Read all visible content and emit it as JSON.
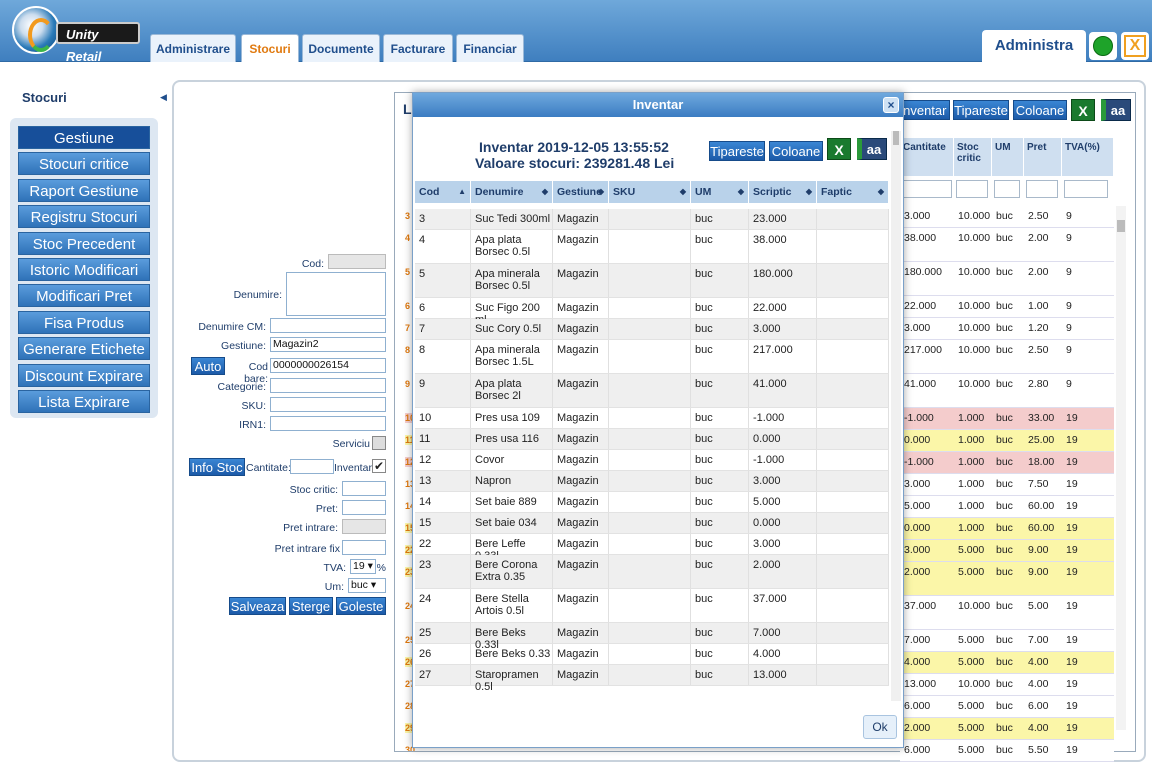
{
  "app": {
    "logo_text": "Unity Retail",
    "user": "Administra",
    "close_label": "X"
  },
  "tabs": [
    {
      "label": "Administrare",
      "active": false
    },
    {
      "label": "Stocuri",
      "active": true
    },
    {
      "label": "Documente",
      "active": false
    },
    {
      "label": "Facturare",
      "active": false
    },
    {
      "label": "Financiar",
      "active": false
    }
  ],
  "sidebar": {
    "title": "Stocuri",
    "items": [
      "Gestiune",
      "Stocuri critice",
      "Raport Gestiune",
      "Registru Stocuri",
      "Stoc Precedent",
      "Istoric Modificari",
      "Modificari Pret",
      "Fisa Produs",
      "Generare Etichete",
      "Discount Expirare",
      "Lista Expirare"
    ]
  },
  "form": {
    "cod_label": "Cod:",
    "denumire_label": "Denumire:",
    "denumire_cm_label": "Denumire CM:",
    "gestiune_label": "Gestiune:",
    "gestiune_value": "Magazin2",
    "auto_label": "Auto",
    "cod_bare_label": "Cod bare:",
    "cod_bare_value": "0000000026154",
    "categorie_label": "Categorie:",
    "sku_label": "SKU:",
    "irn_label": "IRN1:",
    "serviciu_label": "Serviciu",
    "info_stoc_label": "Info Stoc",
    "cantitate_label": "Cantitate:",
    "inventar_label": "Inventar",
    "inventar_checked": "✔",
    "stoc_critic_label": "Stoc critic:",
    "pret_label": "Pret:",
    "pret_intrare_label": "Pret intrare:",
    "pret_intrare_fix_label": "Pret intrare fix",
    "tva_label": "TVA:",
    "tva_value": "19 ▾",
    "tva_unit": "%",
    "um_label": "Um:",
    "um_value": "buc ▾",
    "save_label": "Salveaza",
    "delete_label": "Sterge",
    "clear_label": "Goleste"
  },
  "list": {
    "title_fragment": "Li",
    "toolbar": {
      "inventar_label": "Inventar",
      "print_label": "Tipareste",
      "columns_label": "Coloane",
      "excel_label": "X",
      "font_label": "aa"
    },
    "headers": [
      "Cantitate",
      "Stoc critic",
      "UM",
      "Pret",
      "TVA(%)"
    ],
    "left_fragments": [
      "3",
      "4",
      "5",
      "6",
      "7",
      "8",
      "9",
      "10",
      "11",
      "12",
      "13",
      "14",
      "15",
      "22",
      "23",
      "24",
      "25",
      "26",
      "27",
      "28",
      "29",
      "30"
    ],
    "rows": [
      {
        "qty": "3.000",
        "crit": "10.000",
        "um": "buc",
        "pret": "2.50",
        "tva": "9",
        "status": "normal"
      },
      {
        "qty": "38.000",
        "crit": "10.000",
        "um": "buc",
        "pret": "2.00",
        "tva": "9",
        "status": "normal"
      },
      {
        "qty": "180.000",
        "crit": "10.000",
        "um": "buc",
        "pret": "2.00",
        "tva": "9",
        "status": "normal"
      },
      {
        "qty": "22.000",
        "crit": "10.000",
        "um": "buc",
        "pret": "1.00",
        "tva": "9",
        "status": "normal"
      },
      {
        "qty": "3.000",
        "crit": "10.000",
        "um": "buc",
        "pret": "1.20",
        "tva": "9",
        "status": "normal"
      },
      {
        "qty": "217.000",
        "crit": "10.000",
        "um": "buc",
        "pret": "2.50",
        "tva": "9",
        "status": "normal"
      },
      {
        "qty": "41.000",
        "crit": "10.000",
        "um": "buc",
        "pret": "2.80",
        "tva": "9",
        "status": "normal"
      },
      {
        "qty": "-1.000",
        "crit": "1.000",
        "um": "buc",
        "pret": "33.00",
        "tva": "19",
        "status": "negative"
      },
      {
        "qty": "0.000",
        "crit": "1.000",
        "um": "buc",
        "pret": "25.00",
        "tva": "19",
        "status": "zero"
      },
      {
        "qty": "-1.000",
        "crit": "1.000",
        "um": "buc",
        "pret": "18.00",
        "tva": "19",
        "status": "negative"
      },
      {
        "qty": "3.000",
        "crit": "1.000",
        "um": "buc",
        "pret": "7.50",
        "tva": "19",
        "status": "normal"
      },
      {
        "qty": "5.000",
        "crit": "1.000",
        "um": "buc",
        "pret": "60.00",
        "tva": "19",
        "status": "normal"
      },
      {
        "qty": "0.000",
        "crit": "1.000",
        "um": "buc",
        "pret": "60.00",
        "tva": "19",
        "status": "zero"
      },
      {
        "qty": "3.000",
        "crit": "5.000",
        "um": "buc",
        "pret": "9.00",
        "tva": "19",
        "status": "zero"
      },
      {
        "qty": "2.000",
        "crit": "5.000",
        "um": "buc",
        "pret": "9.00",
        "tva": "19",
        "status": "zero"
      },
      {
        "qty": "37.000",
        "crit": "10.000",
        "um": "buc",
        "pret": "5.00",
        "tva": "19",
        "status": "normal"
      },
      {
        "qty": "7.000",
        "crit": "5.000",
        "um": "buc",
        "pret": "7.00",
        "tva": "19",
        "status": "normal"
      },
      {
        "qty": "4.000",
        "crit": "5.000",
        "um": "buc",
        "pret": "4.00",
        "tva": "19",
        "status": "zero"
      },
      {
        "qty": "13.000",
        "crit": "10.000",
        "um": "buc",
        "pret": "4.00",
        "tva": "19",
        "status": "normal"
      },
      {
        "qty": "6.000",
        "crit": "5.000",
        "um": "buc",
        "pret": "6.00",
        "tva": "19",
        "status": "normal"
      },
      {
        "qty": "2.000",
        "crit": "5.000",
        "um": "buc",
        "pret": "4.00",
        "tva": "19",
        "status": "zero"
      },
      {
        "qty": "6.000",
        "crit": "5.000",
        "um": "buc",
        "pret": "5.50",
        "tva": "19",
        "status": "normal"
      }
    ]
  },
  "dialog": {
    "title": "Inventar",
    "close_icon": "×",
    "heading": "Inventar 2019-12-05 13:55:52",
    "subheading": "Valoare stocuri: 239281.48 Lei",
    "print_label": "Tipareste",
    "columns_label": "Coloane",
    "excel_label": "X",
    "font_label": "aa",
    "ok_label": "Ok",
    "headers": [
      "Cod",
      "Denumire",
      "Gestiune",
      "SKU",
      "UM",
      "Scriptic",
      "Faptic"
    ],
    "rows": [
      {
        "cod": "3",
        "den": "Suc Tedi 300ml",
        "gest": "Magazin",
        "sku": "",
        "um": "buc",
        "scriptic": "23.000",
        "faptic": ""
      },
      {
        "cod": "4",
        "den": "Apa plata Borsec 0.5l",
        "gest": "Magazin",
        "sku": "",
        "um": "buc",
        "scriptic": "38.000",
        "faptic": ""
      },
      {
        "cod": "5",
        "den": "Apa minerala Borsec 0.5l",
        "gest": "Magazin",
        "sku": "",
        "um": "buc",
        "scriptic": "180.000",
        "faptic": ""
      },
      {
        "cod": "6",
        "den": "Suc Figo 200 ml",
        "gest": "Magazin",
        "sku": "",
        "um": "buc",
        "scriptic": "22.000",
        "faptic": ""
      },
      {
        "cod": "7",
        "den": "Suc Cory 0.5l",
        "gest": "Magazin",
        "sku": "",
        "um": "buc",
        "scriptic": "3.000",
        "faptic": ""
      },
      {
        "cod": "8",
        "den": "Apa minerala Borsec 1.5L",
        "gest": "Magazin",
        "sku": "",
        "um": "buc",
        "scriptic": "217.000",
        "faptic": ""
      },
      {
        "cod": "9",
        "den": "Apa plata Borsec 2l",
        "gest": "Magazin",
        "sku": "",
        "um": "buc",
        "scriptic": "41.000",
        "faptic": ""
      },
      {
        "cod": "10",
        "den": "Pres usa 109",
        "gest": "Magazin",
        "sku": "",
        "um": "buc",
        "scriptic": "-1.000",
        "faptic": ""
      },
      {
        "cod": "11",
        "den": "Pres usa 116",
        "gest": "Magazin",
        "sku": "",
        "um": "buc",
        "scriptic": "0.000",
        "faptic": ""
      },
      {
        "cod": "12",
        "den": "Covor",
        "gest": "Magazin",
        "sku": "",
        "um": "buc",
        "scriptic": "-1.000",
        "faptic": ""
      },
      {
        "cod": "13",
        "den": "Napron",
        "gest": "Magazin",
        "sku": "",
        "um": "buc",
        "scriptic": "3.000",
        "faptic": ""
      },
      {
        "cod": "14",
        "den": "Set baie 889",
        "gest": "Magazin",
        "sku": "",
        "um": "buc",
        "scriptic": "5.000",
        "faptic": ""
      },
      {
        "cod": "15",
        "den": "Set baie 034",
        "gest": "Magazin",
        "sku": "",
        "um": "buc",
        "scriptic": "0.000",
        "faptic": ""
      },
      {
        "cod": "22",
        "den": "Bere Leffe 0.33l",
        "gest": "Magazin",
        "sku": "",
        "um": "buc",
        "scriptic": "3.000",
        "faptic": ""
      },
      {
        "cod": "23",
        "den": "Bere Corona Extra 0.35",
        "gest": "Magazin",
        "sku": "",
        "um": "buc",
        "scriptic": "2.000",
        "faptic": ""
      },
      {
        "cod": "24",
        "den": "Bere Stella Artois 0.5l",
        "gest": "Magazin",
        "sku": "",
        "um": "buc",
        "scriptic": "37.000",
        "faptic": ""
      },
      {
        "cod": "25",
        "den": "Bere Beks 0.33l",
        "gest": "Magazin",
        "sku": "",
        "um": "buc",
        "scriptic": "7.000",
        "faptic": ""
      },
      {
        "cod": "26",
        "den": "Bere Beks 0.33",
        "gest": "Magazin",
        "sku": "",
        "um": "buc",
        "scriptic": "4.000",
        "faptic": ""
      },
      {
        "cod": "27",
        "den": "Staropramen 0.5l",
        "gest": "Magazin",
        "sku": "",
        "um": "buc",
        "scriptic": "13.000",
        "faptic": ""
      }
    ]
  },
  "colors": {
    "accent": "#1c5aa8",
    "tab_active": "#e07a10",
    "row_negative": "#f4cccc",
    "row_zero": "#fbf6a8",
    "status_ok": "#1ea32a"
  }
}
